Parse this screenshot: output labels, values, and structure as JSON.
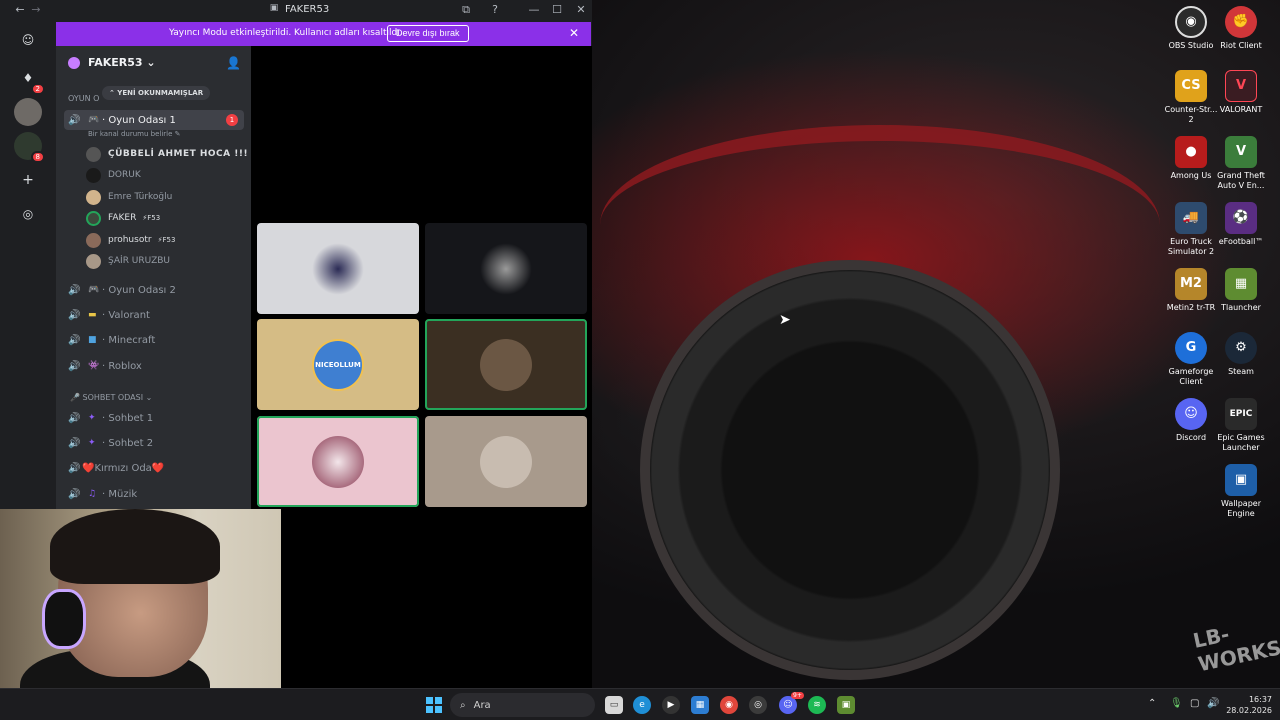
{
  "window": {
    "title": "FAKER53",
    "controls": {
      "minimize": "—",
      "maximize": "☐",
      "close": "✕"
    }
  },
  "banner": {
    "text": "Yayıncı Modu etkinleştirildi. Kullanıcı adları kısaltıldı.",
    "button_label": "Devre dışı bırak",
    "close": "✕"
  },
  "guilds": {
    "dm_badge": "2",
    "server3_badge": "8"
  },
  "server": {
    "name": "FAKER53 ⌄",
    "unread_pill": "⌃ YENİ OKUNMAMIŞLAR",
    "category_game": "OYUN O",
    "category_chat": "🎤 SOHBET ODASI ⌄"
  },
  "channels": {
    "oyun1": {
      "label": "Oyun Odası 1",
      "badge": "1",
      "status": "Bir kanal durumu belirle ✎"
    },
    "oyun2": "Oyun Odası 2",
    "valorant": "Valorant",
    "minecraft": "Minecraft",
    "roblox": "Roblox",
    "sohbet1": "Sohbet 1",
    "sohbet2": "Sohbet 2",
    "kirmizi": "❤️Kırmızı Oda❤️",
    "muzik": "Müzik"
  },
  "members": [
    {
      "name": "ÇÜBBELİ AHMET HOCA !!!",
      "tag": ""
    },
    {
      "name": "DORUK",
      "tag": ""
    },
    {
      "name": "Emre Türkoğlu",
      "tag": ""
    },
    {
      "name": "FAKER",
      "tag": "⚡F53"
    },
    {
      "name": "prohusotr",
      "tag": "⚡F53"
    },
    {
      "name": "ŞAİR URUZBU",
      "tag": ""
    }
  ],
  "tiles": {
    "t3_avatar_text": "NICEOLLUM"
  },
  "desktop_icons": [
    {
      "label": "OBS Studio",
      "icon": "obs-icon",
      "color": "#2b2b2b"
    },
    {
      "label": "Riot Client",
      "icon": "riot-icon",
      "color": "#d13639"
    },
    {
      "label": "Counter-Str... 2",
      "icon": "cs2-icon",
      "color": "#e0a21b"
    },
    {
      "label": "VALORANT",
      "icon": "valorant-icon",
      "color": "#3a1c22"
    },
    {
      "label": "Among Us",
      "icon": "amongus-icon",
      "color": "#b71c1c"
    },
    {
      "label": "Grand Theft Auto V En...",
      "icon": "gta-icon",
      "color": "#3b7d3b"
    },
    {
      "label": "Euro Truck Simulator 2",
      "icon": "ets2-icon",
      "color": "#2e4b6e"
    },
    {
      "label": "eFootball™",
      "icon": "efootball-icon",
      "color": "#5a2d82"
    },
    {
      "label": "Metin2 tr-TR",
      "icon": "metin2-icon",
      "color": "#b5862a"
    },
    {
      "label": "Tlauncher",
      "icon": "tlauncher-icon",
      "color": "#5e8c31"
    },
    {
      "label": "Gameforge Client",
      "icon": "gameforge-icon",
      "color": "#1e6fd9"
    },
    {
      "label": "Steam",
      "icon": "steam-icon",
      "color": "#1b2838"
    },
    {
      "label": "Discord",
      "icon": "discord-icon",
      "color": "#5865f2"
    },
    {
      "label": "Epic Games Launcher",
      "icon": "epic-icon",
      "color": "#2a2a2a"
    },
    {
      "label": "Wallpaper Engine",
      "icon": "wallpaper-engine-icon",
      "color": "#1e5fa8"
    }
  ],
  "desktop": {
    "logo_text": "LB-WORKS"
  },
  "taskbar": {
    "search_label": "Ara",
    "time": "16:37",
    "date": "28.02.2026",
    "discord_badge": "9+"
  }
}
